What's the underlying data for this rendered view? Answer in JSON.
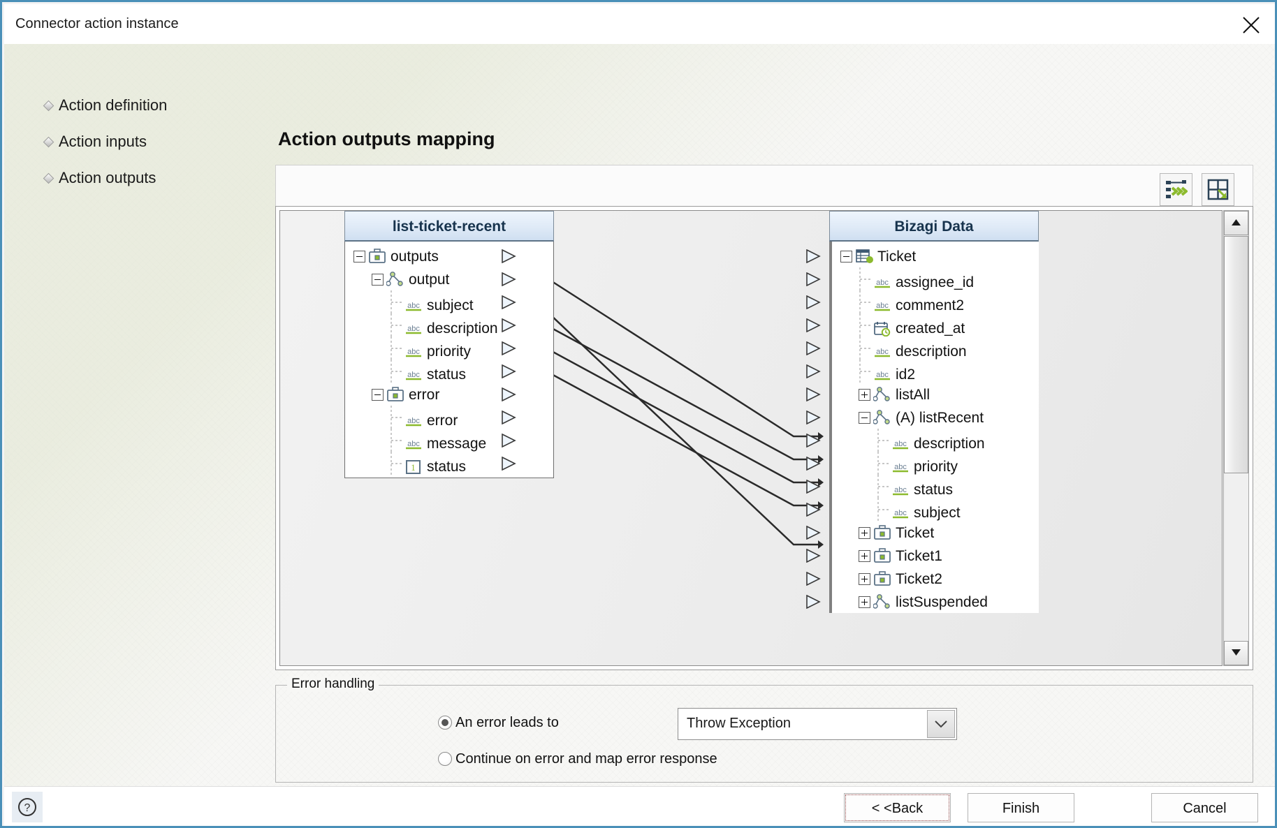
{
  "window": {
    "title": "Connector action instance",
    "close_icon": "close-icon"
  },
  "steps": [
    {
      "label": "Action definition"
    },
    {
      "label": "Action inputs"
    },
    {
      "label": "Action outputs"
    }
  ],
  "page": {
    "title": "Action outputs mapping"
  },
  "toolbar": {
    "automap_icon": "auto-map-icon",
    "expand_icon": "expand-panel-icon"
  },
  "mapper": {
    "left_header": "list-ticket-recent",
    "right_header": "Bizagi Data",
    "left_nodes": [
      {
        "label": "outputs",
        "indent": 0,
        "toggle": "minus",
        "icon": "briefcase-icon",
        "port": true
      },
      {
        "label": "output",
        "indent": 1,
        "toggle": "minus",
        "icon": "object-icon",
        "port": true
      },
      {
        "label": "subject",
        "indent": 2,
        "toggle": "none",
        "icon": "abc-icon",
        "port": true
      },
      {
        "label": "description",
        "indent": 2,
        "toggle": "none",
        "icon": "abc-icon",
        "port": true
      },
      {
        "label": "priority",
        "indent": 2,
        "toggle": "none",
        "icon": "abc-icon",
        "port": true
      },
      {
        "label": "status",
        "indent": 2,
        "toggle": "none",
        "icon": "abc-icon",
        "port": true
      },
      {
        "label": "error",
        "indent": 1,
        "toggle": "minus",
        "icon": "briefcase-icon",
        "port": true
      },
      {
        "label": "error",
        "indent": 2,
        "toggle": "none",
        "icon": "abc-icon",
        "port": true
      },
      {
        "label": "message",
        "indent": 2,
        "toggle": "none",
        "icon": "abc-icon",
        "port": true
      },
      {
        "label": "status",
        "indent": 2,
        "toggle": "none",
        "icon": "number-icon",
        "port": true
      }
    ],
    "right_nodes": [
      {
        "label": "Ticket",
        "indent": 0,
        "toggle": "minus",
        "icon": "entity-icon",
        "port": true
      },
      {
        "label": "assignee_id",
        "indent": 1,
        "toggle": "none",
        "icon": "abc-icon",
        "port": true
      },
      {
        "label": "comment2",
        "indent": 1,
        "toggle": "none",
        "icon": "abc-icon",
        "port": true
      },
      {
        "label": "created_at",
        "indent": 1,
        "toggle": "none",
        "icon": "datetime-icon",
        "port": true
      },
      {
        "label": "description",
        "indent": 1,
        "toggle": "none",
        "icon": "abc-icon",
        "port": true
      },
      {
        "label": "id2",
        "indent": 1,
        "toggle": "none",
        "icon": "abc-icon",
        "port": true
      },
      {
        "label": "listAll",
        "indent": 1,
        "toggle": "plus",
        "icon": "object-icon",
        "port": true
      },
      {
        "label": "(A) listRecent",
        "indent": 1,
        "toggle": "minus",
        "icon": "object-icon",
        "port": true
      },
      {
        "label": "description",
        "indent": 2,
        "toggle": "none",
        "icon": "abc-icon",
        "port": true
      },
      {
        "label": "priority",
        "indent": 2,
        "toggle": "none",
        "icon": "abc-icon",
        "port": true
      },
      {
        "label": "status",
        "indent": 2,
        "toggle": "none",
        "icon": "abc-icon",
        "port": true
      },
      {
        "label": "subject",
        "indent": 2,
        "toggle": "none",
        "icon": "abc-icon",
        "port": true
      },
      {
        "label": "Ticket",
        "indent": 1,
        "toggle": "plus",
        "icon": "briefcase-icon",
        "port": true
      },
      {
        "label": "Ticket1",
        "indent": 1,
        "toggle": "plus",
        "icon": "briefcase-icon",
        "port": true
      },
      {
        "label": "Ticket2",
        "indent": 1,
        "toggle": "plus",
        "icon": "briefcase-icon",
        "port": true
      },
      {
        "label": "listSuspended",
        "indent": 1,
        "toggle": "plus",
        "icon": "object-icon",
        "port": true
      }
    ],
    "links": [
      {
        "from": "output",
        "to": "(A) listRecent"
      },
      {
        "from": "subject",
        "to": "subject"
      },
      {
        "from": "description",
        "to": "description"
      },
      {
        "from": "priority",
        "to": "priority"
      },
      {
        "from": "status",
        "to": "status"
      }
    ],
    "scrollbar": {
      "up_icon": "scroll-up-icon",
      "down_icon": "scroll-down-icon"
    }
  },
  "error_handling": {
    "legend": "Error handling",
    "option_1": "An error leads to",
    "option_2": "Continue on error and map error response",
    "selected_option": 1,
    "select_value": "Throw Exception",
    "select_arrow_icon": "chevron-down-icon"
  },
  "footer": {
    "help_icon": "help-icon",
    "back": "< <Back",
    "finish": "Finish",
    "cancel": "Cancel"
  }
}
